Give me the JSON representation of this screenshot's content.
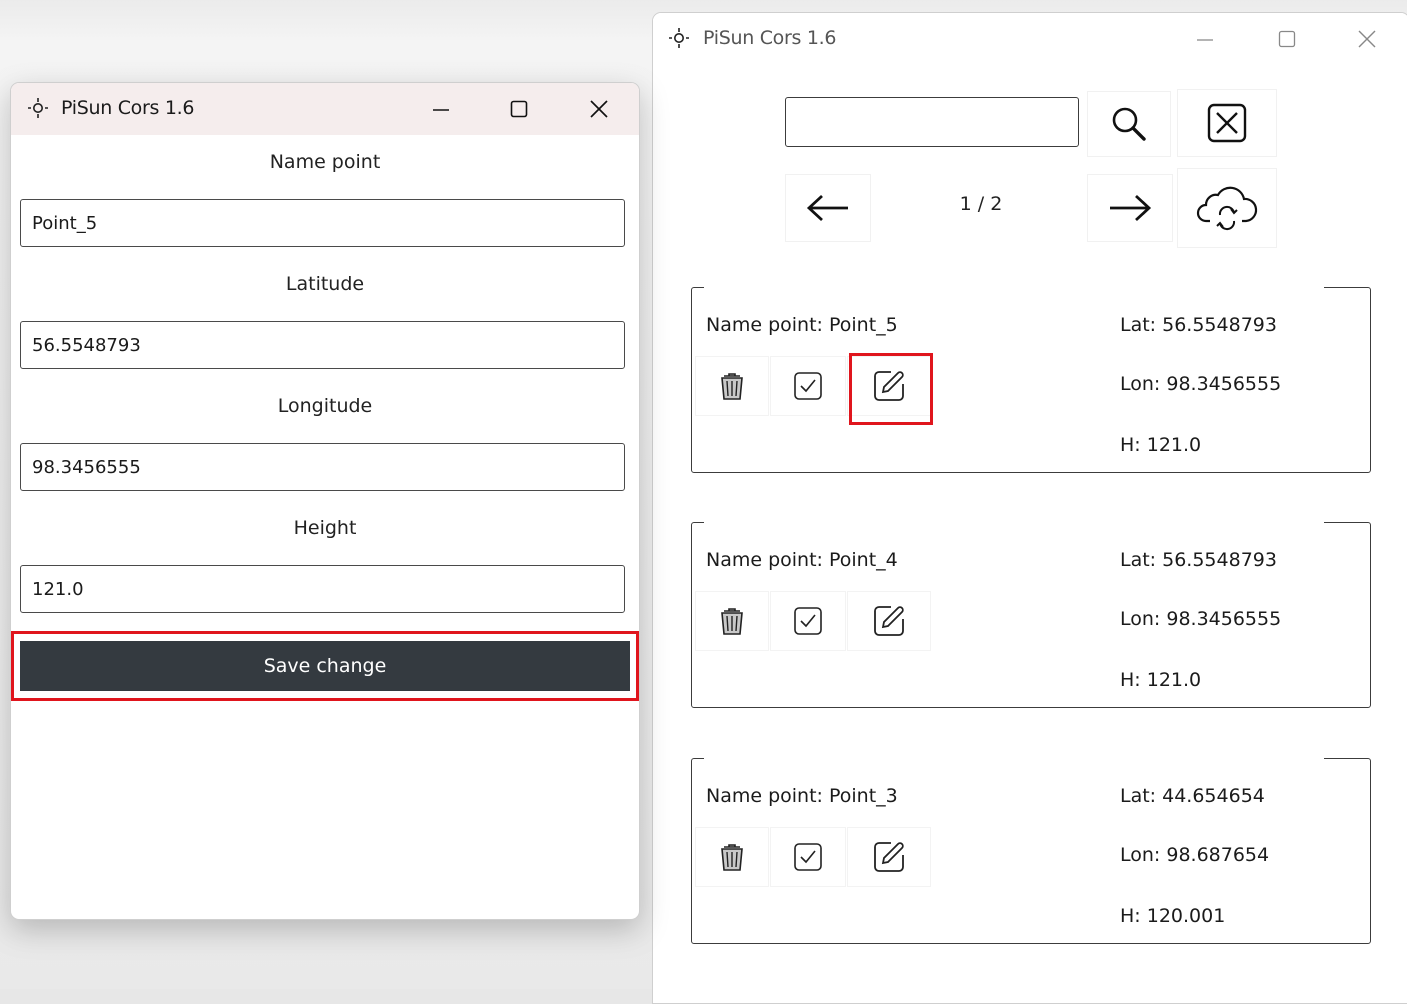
{
  "colors": {
    "accent_highlight": "#e0151d",
    "save_button_bg": "#343a40",
    "edit_titlebar": "#f5eded"
  },
  "edit_window": {
    "title": "PiSun Cors 1.6",
    "icons": {
      "app": "crosshair-icon",
      "minimize": "minimize-icon",
      "maximize": "maximize-icon",
      "close": "close-icon"
    },
    "fields": [
      {
        "label": "Name point",
        "value": "Point_5"
      },
      {
        "label": "Latitude",
        "value": "56.5548793"
      },
      {
        "label": "Longitude",
        "value": "98.3456555"
      },
      {
        "label": "Height",
        "value": "121.0"
      }
    ],
    "save_label": "Save change"
  },
  "list_window": {
    "title": "PiSun Cors 1.6",
    "search": {
      "value": "",
      "placeholder": ""
    },
    "toolbar_icons": {
      "search": "search-icon",
      "clear": "clear-x-icon",
      "prev": "arrow-left-icon",
      "next": "arrow-right-icon",
      "sync": "cloud-sync-icon"
    },
    "page_indicator": "1 / 2",
    "points": [
      {
        "name": "Name point: Point_5",
        "lat": "Lat: 56.5548793",
        "lon": "Lon: 98.3456555",
        "h": "H: 121.0"
      },
      {
        "name": "Name point: Point_4",
        "lat": "Lat: 56.5548793",
        "lon": "Lon: 98.3456555",
        "h": "H: 121.0"
      },
      {
        "name": "Name point: Point_3",
        "lat": "Lat: 44.654654",
        "lon": "Lon: 98.687654",
        "h": "H: 120.001"
      }
    ],
    "row_icons": {
      "delete": "trash-icon",
      "select": "checkbox-icon",
      "edit": "edit-pencil-icon"
    }
  }
}
